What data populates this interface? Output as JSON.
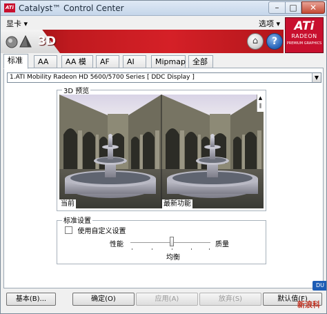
{
  "window": {
    "title": "Catalyst™ Control Center",
    "controls": {
      "minimize": "–",
      "maximize": "□",
      "close": "✕"
    }
  },
  "menu": {
    "graphics": "显卡 ▾",
    "options": "选项 ▾"
  },
  "header": {
    "title": "3D",
    "home_icon": "⌂",
    "help_icon": "?"
  },
  "logo": {
    "brand": "ATi",
    "product": "RADEON",
    "tagline": "PREMIUM GRAPHICS"
  },
  "tabs": [
    {
      "label": "标准",
      "active": true
    },
    {
      "label": "AA"
    },
    {
      "label": "AA 模式"
    },
    {
      "label": "AF"
    },
    {
      "label": "AI"
    },
    {
      "label": "Mipmap"
    },
    {
      "label": "全部"
    }
  ],
  "device_select": {
    "value": "1.ATI Mobility Radeon HD 5600/5700 Series [ DDC Display ]",
    "arrow": "▼"
  },
  "preview": {
    "group_label": "3D 预览",
    "current_label": "当前",
    "latest_label": "最新功能",
    "scroll_glyph": "▲\n‖"
  },
  "standard_settings": {
    "group_label": "标准设置",
    "custom_checkbox": "使用自定义设置",
    "custom_checked": false,
    "slider_left": "性能",
    "slider_right": "质量",
    "slider_center": "均衡",
    "slider_position": "middle"
  },
  "buttons": {
    "basic": "基本(B)...",
    "ok": "确定(O)",
    "apply": "应用(A)",
    "discard": "放弃(S)",
    "defaults": "默认值(F)"
  },
  "overlay": {
    "du_tag": "DU",
    "watermark": "新浪科"
  }
}
